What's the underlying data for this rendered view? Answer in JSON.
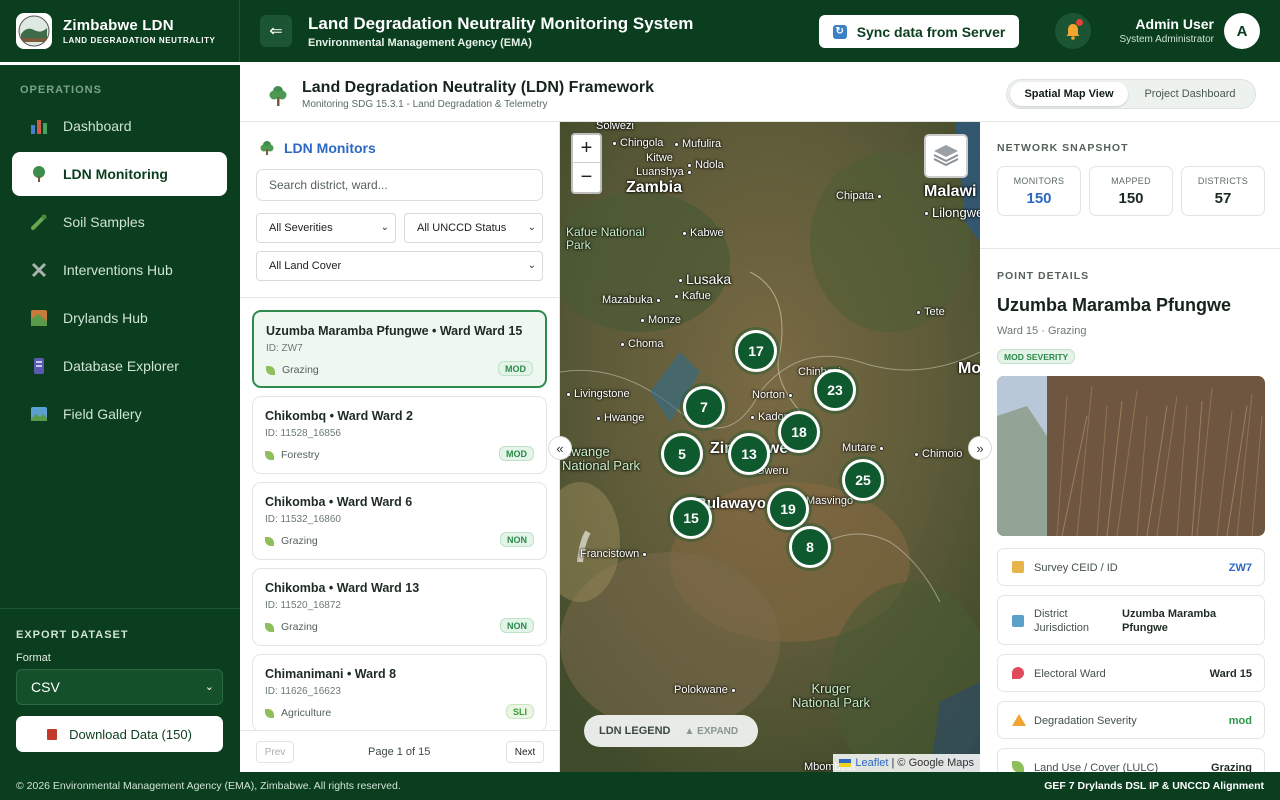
{
  "brand": {
    "title": "Zimbabwe LDN",
    "subtitle": "LAND DEGRADATION NEUTRALITY"
  },
  "header": {
    "title": "Land Degradation Neutrality Monitoring System",
    "subtitle": "Environmental Management Agency (EMA)",
    "sync_label": "Sync data from Server",
    "user_name": "Admin User",
    "user_role": "System Administrator",
    "avatar_letter": "A"
  },
  "sidebar": {
    "section_label": "OPERATIONS",
    "items": [
      {
        "label": "Dashboard",
        "icon": "bar-chart-icon",
        "color": "#4a7fd0"
      },
      {
        "label": "LDN Monitoring",
        "icon": "tree-icon",
        "color": "#3e8d4a"
      },
      {
        "label": "Soil Samples",
        "icon": "pipette-icon",
        "color": "#6aa84f"
      },
      {
        "label": "Interventions Hub",
        "icon": "tools-icon",
        "color": "#9aa4a0"
      },
      {
        "label": "Drylands Hub",
        "icon": "map-icon",
        "color": "#c77a3a"
      },
      {
        "label": "Database Explorer",
        "icon": "database-icon",
        "color": "#5a5ab0"
      },
      {
        "label": "Field Gallery",
        "icon": "image-icon",
        "color": "#5aa0d0"
      }
    ],
    "active_index": 1,
    "export": {
      "label": "EXPORT DATASET",
      "format_label": "Format",
      "format_value": "CSV",
      "download_label": "Download Data (150)"
    }
  },
  "page": {
    "title": "Land Degradation Neutrality (LDN) Framework",
    "subtitle": "Monitoring SDG 15.3.1 - Land Degradation & Telemetry",
    "view_map": "Spatial Map View",
    "view_dashboard": "Project Dashboard"
  },
  "list": {
    "title": "LDN Monitors",
    "search_placeholder": "Search district, ward...",
    "filter_severity": "All Severities",
    "filter_status": "All UNCCD Status",
    "filter_cover": "All Land Cover",
    "cards": [
      {
        "title": "Uzumba Maramba Pfungwe • Ward Ward 15",
        "id": "ID: ZW7",
        "cover": "Grazing",
        "badge": "MOD"
      },
      {
        "title": "Chikombq • Ward Ward 2",
        "id": "ID: 11528_16856",
        "cover": "Forestry",
        "badge": "MOD"
      },
      {
        "title": "Chikomba • Ward Ward 6",
        "id": "ID: 11532_16860",
        "cover": "Grazing",
        "badge": "NON"
      },
      {
        "title": "Chikomba • Ward Ward 13",
        "id": "ID: 11520_16872",
        "cover": "Grazing",
        "badge": "NON"
      },
      {
        "title": "Chimanimani • Ward 8",
        "id": "ID: 11626_16623",
        "cover": "Agriculture",
        "badge": "SLI"
      }
    ],
    "pager": {
      "prev": "Prev",
      "info": "Page 1 of 15",
      "next": "Next"
    }
  },
  "map": {
    "places": [
      {
        "name": "Solwezi"
      },
      {
        "name": "Chingola"
      },
      {
        "name": "Mufulira"
      },
      {
        "name": "Kitwe"
      },
      {
        "name": "Ndola"
      },
      {
        "name": "Luanshya"
      },
      {
        "name": "Zambia"
      },
      {
        "name": "Chipata"
      },
      {
        "name": "Malawi"
      },
      {
        "name": "Lilongwe"
      },
      {
        "name": "Kafue National Park"
      },
      {
        "name": "Kabwe"
      },
      {
        "name": "Lusaka"
      },
      {
        "name": "Mazabuka"
      },
      {
        "name": "Kafue"
      },
      {
        "name": "Tete"
      },
      {
        "name": "Monze"
      },
      {
        "name": "Choma"
      },
      {
        "name": "Chinhoyi"
      },
      {
        "name": "Livingstone"
      },
      {
        "name": "Norton"
      },
      {
        "name": "Hwange"
      },
      {
        "name": "Kadoma"
      },
      {
        "name": "Hwange National Park"
      },
      {
        "name": "Zimbabwe"
      },
      {
        "name": "Mutare"
      },
      {
        "name": "Chimoio"
      },
      {
        "name": "Gweru"
      },
      {
        "name": "Bulawayo"
      },
      {
        "name": "Masvingo"
      },
      {
        "name": "Francistown"
      },
      {
        "name": "Polokwane"
      },
      {
        "name": "Kruger National Park"
      },
      {
        "name": "Mbombela"
      },
      {
        "name": "Mo"
      }
    ],
    "clusters": [
      17,
      23,
      7,
      18,
      5,
      13,
      25,
      15,
      19,
      8
    ],
    "legend_label": "LDN LEGEND",
    "legend_expand": "▲ EXPAND",
    "attribution_leaflet": "Leaflet",
    "attribution_rest": "| © Google Maps"
  },
  "snapshot": {
    "label": "NETWORK SNAPSHOT",
    "monitors_label": "MONITORS",
    "monitors_value": "150",
    "mapped_label": "MAPPED",
    "mapped_value": "150",
    "districts_label": "DISTRICTS",
    "districts_value": "57"
  },
  "point": {
    "label": "POINT DETAILS",
    "title": "Uzumba Maramba Pfungwe",
    "subtitle": "Ward 15 · Grazing",
    "badge": "MOD SEVERITY",
    "rows": [
      {
        "label": "Survey CEID / ID",
        "value": "ZW7"
      },
      {
        "label": "District Jurisdiction",
        "value": "Uzumba Maramba Pfungwe"
      },
      {
        "label": "Electoral Ward",
        "value": "Ward 15"
      },
      {
        "label": "Degradation Severity",
        "value": "mod"
      },
      {
        "label": "Land Use / Cover (LULC)",
        "value": "Grazing"
      }
    ]
  },
  "footer": {
    "left": "© 2026 Environmental Management Agency (EMA), Zimbabwe. All rights reserved.",
    "right": "GEF 7 Drylands DSL IP & UNCCD Alignment"
  },
  "colors": {
    "primary": "#0b3d1f",
    "accent_blue": "#2c68c4",
    "cluster": "#0e5a2e"
  }
}
